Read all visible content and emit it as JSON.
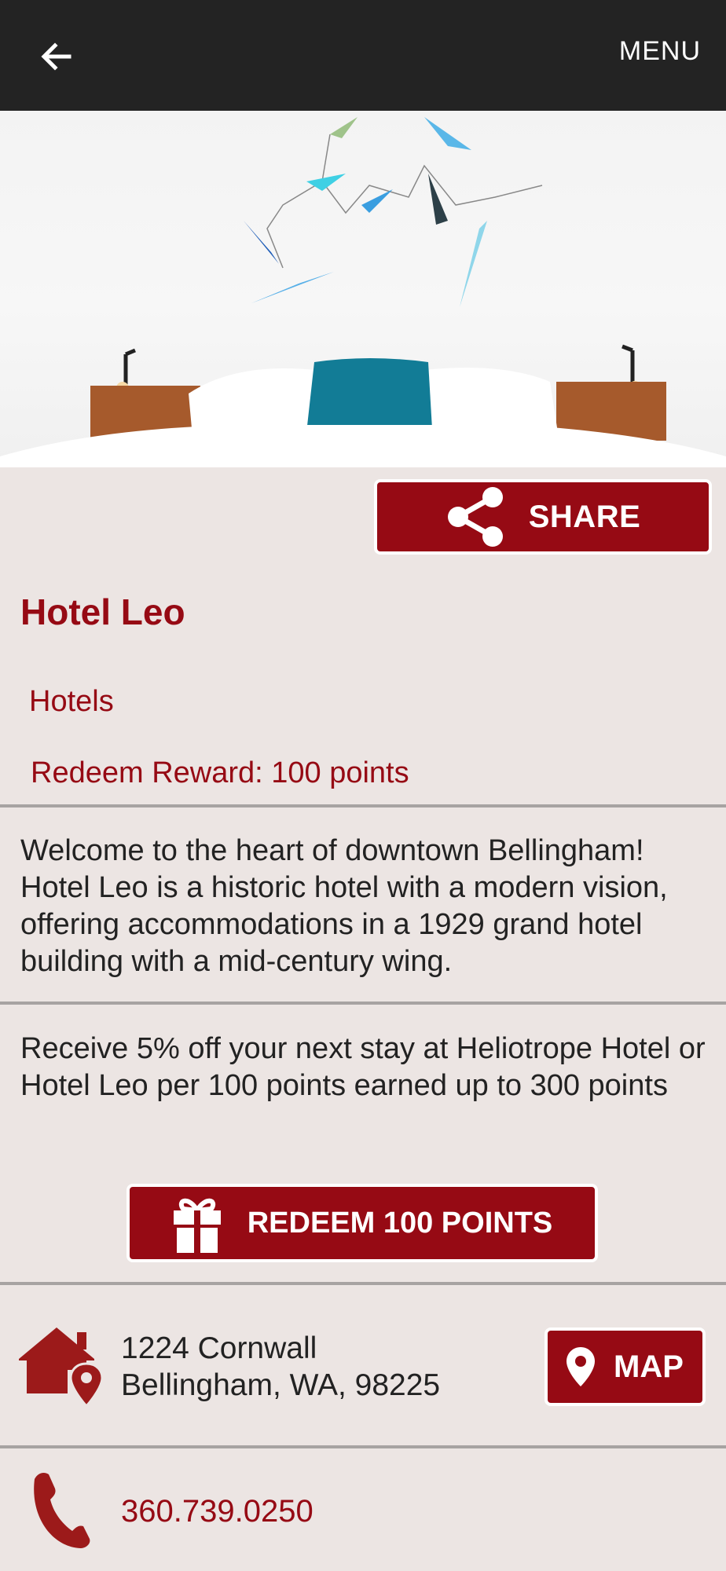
{
  "app_bar": {
    "back_icon": "arrow-left-icon",
    "menu_label": "MENU"
  },
  "hero": {
    "description_icon": "hotel-room-photo"
  },
  "share": {
    "label": "SHARE",
    "icon": "share-icon"
  },
  "listing": {
    "title": "Hotel Leo",
    "category": "Hotels",
    "reward": "Redeem Reward: 100 points",
    "description": "Welcome to the heart of downtown Bellingham! Hotel Leo is a historic hotel with a modern vision, offering accommodations in a 1929 grand hotel building with a mid-century wing.",
    "offer": "Receive 5% off your next stay at Heliotrope Hotel or Hotel Leo per 100 points earned up to 300 points"
  },
  "redeem": {
    "label": "REDEEM 100 POINTS",
    "icon": "gift-icon"
  },
  "address": {
    "line1": "1224 Cornwall",
    "line2": "Bellingham, WA, 98225",
    "icon": "home-location-icon"
  },
  "map": {
    "label": "MAP",
    "icon": "map-pin-icon"
  },
  "phone": {
    "number": "360.739.0250",
    "icon": "phone-icon"
  },
  "colors": {
    "brand": "#960a14",
    "background": "#ece5e3",
    "topbar": "#232323"
  }
}
